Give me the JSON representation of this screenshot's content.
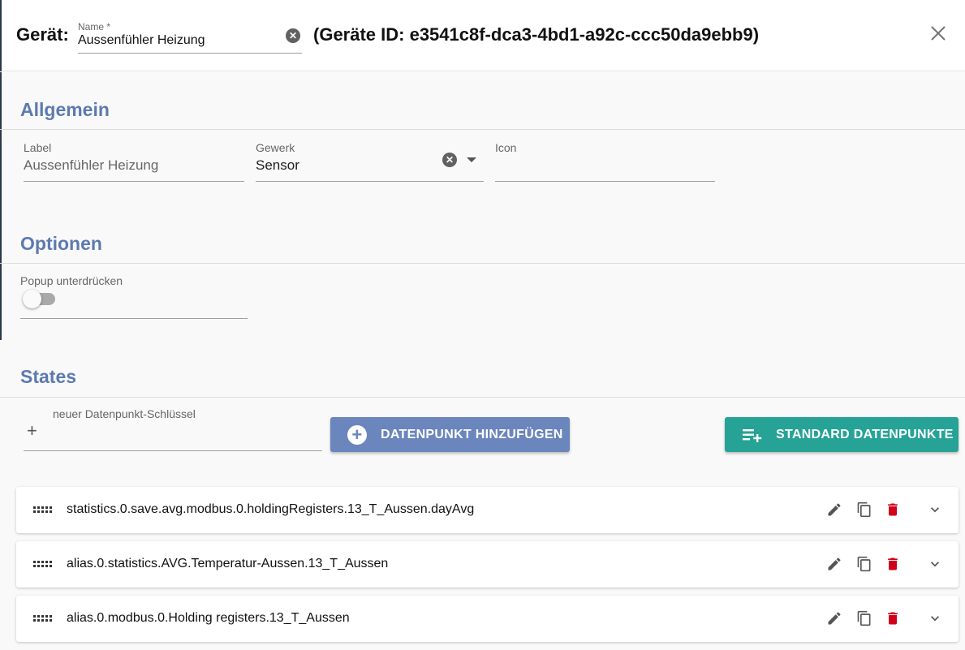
{
  "header": {
    "title_label": "Gerät:",
    "name_label": "Name *",
    "name_value": "Aussenfühler Heizung",
    "device_id_text": "(Geräte ID: e3541c8f-dca3-4bd1-a92c-ccc50da9ebb9)"
  },
  "sections": {
    "general": {
      "title": "Allgemein",
      "label_field": {
        "label": "Label",
        "value": "Aussenfühler Heizung"
      },
      "gewerk_field": {
        "label": "Gewerk",
        "value": "Sensor"
      },
      "icon_field": {
        "label": "Icon",
        "value": ""
      }
    },
    "options": {
      "title": "Optionen",
      "popup_label": "Popup unterdrücken",
      "popup_enabled": false
    },
    "states": {
      "title": "States",
      "new_key_label": "neuer Datenpunkt-Schlüssel",
      "new_key_value": "",
      "add_button_label": "DATENPUNKT HINZUFÜGEN",
      "standard_button_label": "STANDARD DATENPUNKTE",
      "items": [
        {
          "key": "statistics.0.save.avg.modbus.0.holdingRegisters.13_T_Aussen.dayAvg"
        },
        {
          "key": "alias.0.statistics.AVG.Temperatur-Aussen.13_T_Aussen"
        },
        {
          "key": "alias.0.modbus.0.Holding registers.13_T_Aussen"
        }
      ]
    }
  },
  "colors": {
    "section_title": "#5c7ab0",
    "add_button": "#6b85bd",
    "standard_button": "#26a396",
    "delete_icon": "#d0021b"
  },
  "icons": [
    "clear-icon",
    "close-icon",
    "dropdown-arrow-icon",
    "plus-icon",
    "plus-circle-icon",
    "playlist-add-icon",
    "drag-handle-icon",
    "edit-icon",
    "copy-icon",
    "delete-icon",
    "expand-icon"
  ]
}
